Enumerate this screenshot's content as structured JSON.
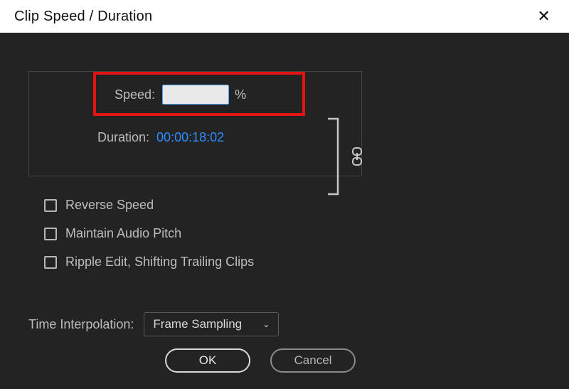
{
  "titlebar": {
    "title": "Clip Speed / Duration"
  },
  "fields": {
    "speed_label": "Speed:",
    "speed_value": "",
    "speed_unit": "%",
    "duration_label": "Duration:",
    "duration_value": "00:00:18:02"
  },
  "link": {
    "tooltip": "Link speed and duration",
    "linked": true
  },
  "checkboxes": {
    "reverse": "Reverse Speed",
    "maintain_pitch": "Maintain Audio Pitch",
    "ripple_edit": "Ripple Edit, Shifting Trailing Clips"
  },
  "interpolation": {
    "label": "Time Interpolation:",
    "selected": "Frame Sampling"
  },
  "buttons": {
    "ok": "OK",
    "cancel": "Cancel"
  },
  "highlight": {
    "target": "speed-field",
    "color": "#e31313"
  }
}
